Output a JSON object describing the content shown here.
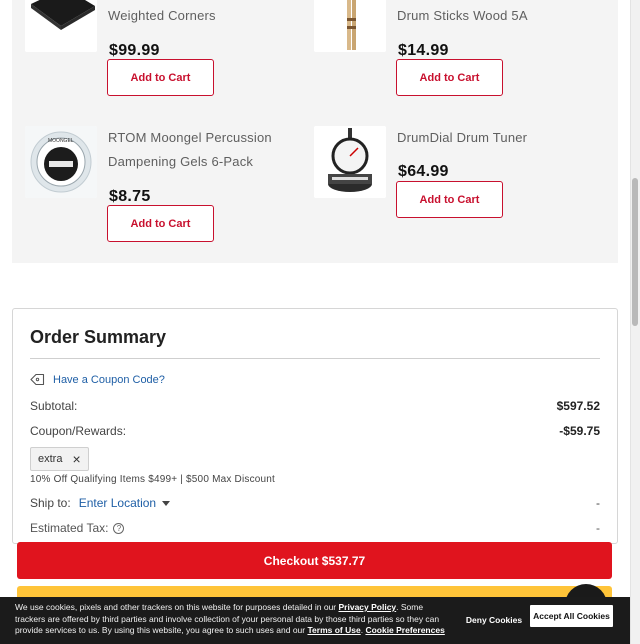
{
  "recommendations": [
    {
      "name_lines": [
        "Weighted Corners"
      ],
      "price": "$99.99",
      "button": "Add to Cart",
      "image": "drum-mat-thumbnail"
    },
    {
      "name_lines": [
        "Drum Sticks Wood 5A"
      ],
      "price": "$14.99",
      "button": "Add to Cart",
      "image": "drum-sticks-thumbnail"
    },
    {
      "name_lines": [
        "RTOM Moongel Percussion",
        "Dampening Gels 6-Pack"
      ],
      "price": "$8.75",
      "button": "Add to Cart",
      "image": "moongel-thumbnail",
      "brand_text": "MOONGEL"
    },
    {
      "name_lines": [
        "DrumDial Drum Tuner"
      ],
      "price": "$64.99",
      "button": "Add to Cart",
      "image": "drumdial-thumbnail"
    }
  ],
  "order_summary": {
    "title": "Order Summary",
    "coupon_link": "Have a Coupon Code?",
    "subtotal_label": "Subtotal:",
    "subtotal_value": "$597.52",
    "coupon_label": "Coupon/Rewards:",
    "coupon_value": "-$59.75",
    "applied_code": "extra",
    "promo_note": "10% Off Qualifying Items $499+ | $500 Max Discount",
    "ship_label": "Ship to:",
    "ship_location": "Enter Location",
    "ship_value": "-",
    "tax_label": "Estimated Tax:",
    "tax_value": "-"
  },
  "checkout": {
    "label": "Checkout $537.77",
    "color": "#e0141e"
  },
  "cookie_banner": {
    "text_1": "We use cookies, pixels and other trackers on this website for purposes detailed in our ",
    "privacy_link": "Privacy Policy",
    "text_2": ". Some trackers are offered by third parties and involve collection of your personal data by those third parties so they can provide services to us. By using this website, you agree to such uses and our ",
    "terms_link": "Terms of Use",
    "text_3": ". ",
    "prefs_link": "Cookie Preferences",
    "deny_label": "Deny Cookies",
    "accept_label": "Accept All Cookies"
  },
  "colors": {
    "accent_red": "#c8102e",
    "link_blue": "#1f5fa6",
    "paypal_yellow": "#ffc439"
  }
}
